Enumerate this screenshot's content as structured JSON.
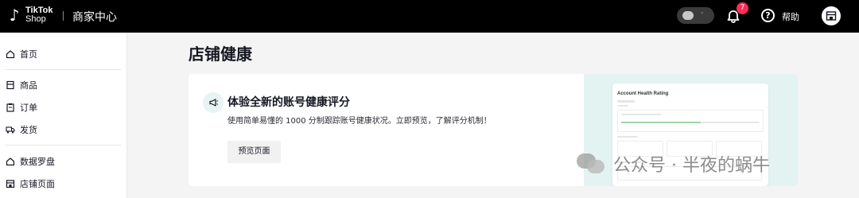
{
  "topbar": {
    "logo_line1": "TikTok",
    "logo_line2": "Shop",
    "title": "商家中心",
    "chat_pill_text": "-",
    "notification_count": "7",
    "help_label": "帮助",
    "colors": {
      "background": "#000000",
      "badge": "#fe2c55"
    }
  },
  "sidebar": {
    "items": [
      {
        "label": "首页",
        "icon": "home-icon"
      },
      {
        "label": "商品",
        "icon": "product-icon"
      },
      {
        "label": "订单",
        "icon": "order-icon"
      },
      {
        "label": "发货",
        "icon": "truck-icon"
      },
      {
        "label": "数据罗盘",
        "icon": "compass-icon"
      },
      {
        "label": "店铺页面",
        "icon": "store-icon"
      }
    ]
  },
  "main": {
    "page_title": "店铺健康",
    "card": {
      "heading": "体验全新的账号健康评分",
      "description": "使用简单易懂的 1000 分制跟踪账号健康状况。立即预览，了解评分机制！",
      "button_label": "预览页面",
      "preview_title": "Account Health Rating",
      "accent_color": "#e3f3f1"
    }
  },
  "watermark": {
    "text": "公众号 · 半夜的蜗牛"
  }
}
